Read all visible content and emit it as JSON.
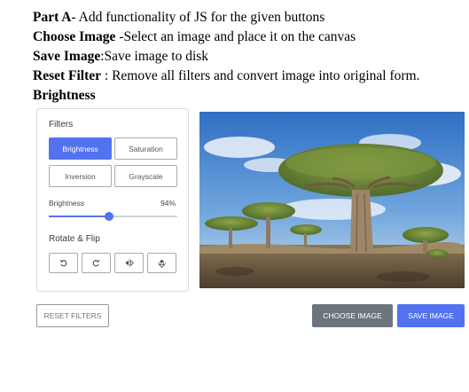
{
  "instructions": {
    "line1": {
      "bold": "Part A",
      "text": "- Add functionality of JS for  the given buttons"
    },
    "line2": {
      "bold": "Choose Image",
      "text": " -Select an image and place it on the canvas"
    },
    "line3": {
      "bold": "Save Image",
      "text": ":Save image to disk"
    },
    "line4": {
      "bold": "Reset Filter",
      "text": " : Remove all filters and convert image into original form."
    },
    "line5": {
      "bold": "Brightness",
      "text": ""
    }
  },
  "editor": {
    "filters_title": "Filters",
    "options": {
      "brightness": "Brightness",
      "saturation": "Saturation",
      "inversion": "Inversion",
      "grayscale": "Grayscale"
    },
    "active_option": "brightness",
    "slider": {
      "label": "Brightness",
      "value_text": "94%",
      "value": 0.47
    },
    "rotate_title": "Rotate & Flip",
    "icons": {
      "rotate_left": "rotate-left-icon",
      "rotate_right": "rotate-right-icon",
      "flip_horizontal": "flip-horizontal-icon",
      "flip_vertical": "flip-vertical-icon"
    }
  },
  "buttons": {
    "reset": "RESET FILTERS",
    "choose": "CHOOSE IMAGE",
    "save": "SAVE IMAGE"
  },
  "colors": {
    "accent": "#5372f0",
    "secondary": "#6c757d"
  }
}
